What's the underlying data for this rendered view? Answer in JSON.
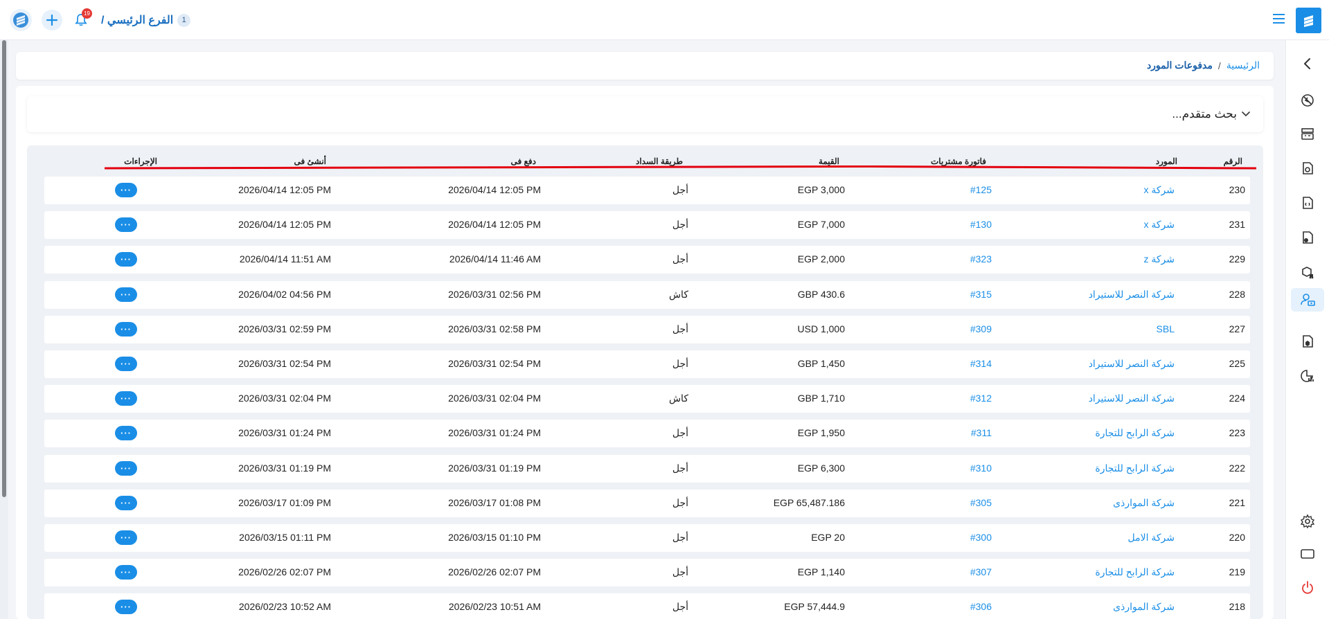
{
  "topbar": {
    "branch_number": "1",
    "branch_label": "الفرع الرئيسي /",
    "notification_count": "19"
  },
  "breadcrumb": {
    "home": "الرئيسية",
    "separator": "/",
    "current": "مدفوعات المورد"
  },
  "search": {
    "advanced_label": "بحث متقدم..."
  },
  "table": {
    "headers": {
      "number": "الرقم",
      "vendor": "المورد",
      "invoice": "فاتورة مشتريات",
      "amount": "القيمة",
      "method": "طريقة السداد",
      "paid_at": "دفع فى",
      "created_at": "أنشئ فى",
      "actions": "الإجراءات"
    },
    "action_label": "···",
    "rows": [
      {
        "number": "230",
        "vendor": "شركة x",
        "invoice": "#125",
        "amount": "EGP 3,000",
        "method": "أجل",
        "paid_at": "2026/04/14 12:05 PM",
        "created_at": "2026/04/14 12:05 PM"
      },
      {
        "number": "231",
        "vendor": "شركة x",
        "invoice": "#130",
        "amount": "EGP 7,000",
        "method": "أجل",
        "paid_at": "2026/04/14 12:05 PM",
        "created_at": "2026/04/14 12:05 PM"
      },
      {
        "number": "229",
        "vendor": "شركة z",
        "invoice": "#323",
        "amount": "EGP 2,000",
        "method": "أجل",
        "paid_at": "2026/04/14 11:46 AM",
        "created_at": "2026/04/14 11:51 AM"
      },
      {
        "number": "228",
        "vendor": "شركة النصر للاستيراد",
        "invoice": "#315",
        "amount": "GBP 430.6",
        "method": "كاش",
        "paid_at": "2026/03/31 02:56 PM",
        "created_at": "2026/04/02 04:56 PM"
      },
      {
        "number": "227",
        "vendor": "SBL",
        "invoice": "#309",
        "amount": "USD 1,000",
        "method": "أجل",
        "paid_at": "2026/03/31 02:58 PM",
        "created_at": "2026/03/31 02:59 PM"
      },
      {
        "number": "225",
        "vendor": "شركة النصر للاستيراد",
        "invoice": "#314",
        "amount": "GBP 1,450",
        "method": "أجل",
        "paid_at": "2026/03/31 02:54 PM",
        "created_at": "2026/03/31 02:54 PM"
      },
      {
        "number": "224",
        "vendor": "شركة النصر للاستيراد",
        "invoice": "#312",
        "amount": "GBP 1,710",
        "method": "كاش",
        "paid_at": "2026/03/31 02:04 PM",
        "created_at": "2026/03/31 02:04 PM"
      },
      {
        "number": "223",
        "vendor": "شركة الرابح للتجارة",
        "invoice": "#311",
        "amount": "EGP 1,950",
        "method": "أجل",
        "paid_at": "2026/03/31 01:24 PM",
        "created_at": "2026/03/31 01:24 PM"
      },
      {
        "number": "222",
        "vendor": "شركة الرابح للتجارة",
        "invoice": "#310",
        "amount": "EGP 6,300",
        "method": "أجل",
        "paid_at": "2026/03/31 01:19 PM",
        "created_at": "2026/03/31 01:19 PM"
      },
      {
        "number": "221",
        "vendor": "شركة الموارذى",
        "invoice": "#305",
        "amount": "EGP 65,487.186",
        "method": "أجل",
        "paid_at": "2026/03/17 01:08 PM",
        "created_at": "2026/03/17 01:09 PM"
      },
      {
        "number": "220",
        "vendor": "شركة الامل",
        "invoice": "#300",
        "amount": "EGP 20",
        "method": "أجل",
        "paid_at": "2026/03/15 01:10 PM",
        "created_at": "2026/03/15 01:11 PM"
      },
      {
        "number": "219",
        "vendor": "شركة الرابح للتجارة",
        "invoice": "#307",
        "amount": "EGP 1,140",
        "method": "أجل",
        "paid_at": "2026/02/26 02:07 PM",
        "created_at": "2026/02/26 02:07 PM"
      },
      {
        "number": "218",
        "vendor": "شركة الموارذى",
        "invoice": "#306",
        "amount": "EGP 57,444.9",
        "method": "أجل",
        "paid_at": "2026/02/23 10:51 AM",
        "created_at": "2026/02/23 10:52 AM"
      }
    ]
  },
  "sidebar": {
    "items": [
      "collapse-icon",
      "dashboard-icon",
      "cash-register-icon",
      "sales-icon",
      "invoice-icon",
      "purchases-icon",
      "inventory-icon",
      "vendor-payments-icon",
      "products-icon",
      "reports-icon",
      "settings-icon",
      "screen-icon",
      "power-icon"
    ]
  },
  "colors": {
    "accent": "#1a8ee6",
    "highlight_line": "#e3000f",
    "badge": "#e53935"
  }
}
